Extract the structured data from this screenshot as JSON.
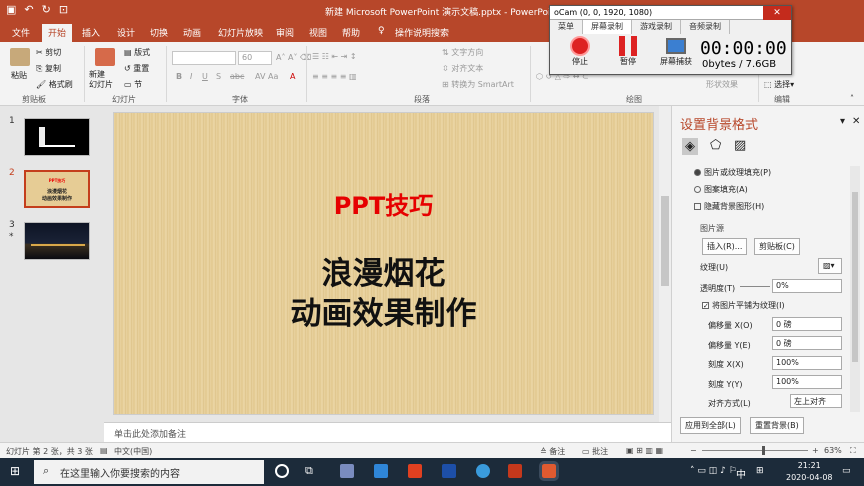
{
  "window": {
    "title": "新建 Microsoft PowerPoint 演示文稿.pptx - PowerPoint",
    "app_name": "PowerPoint"
  },
  "tabs": [
    "文件",
    "开始",
    "插入",
    "设计",
    "切换",
    "动画",
    "幻灯片放映",
    "审阅",
    "视图",
    "帮助",
    "操作说明搜索"
  ],
  "active_tab": "开始",
  "ribbon": {
    "clipboard": {
      "paste": "粘贴",
      "cut": "剪切",
      "copy": "复制",
      "format_painter": "格式刷",
      "label": "剪贴板"
    },
    "slides": {
      "new_slide": "新建\n幻灯片",
      "layout": "版式",
      "reset": "重置",
      "section": "节",
      "label": "幻灯片"
    },
    "font": {
      "label": "字体",
      "size": "60"
    },
    "paragraph": {
      "label": "段落",
      "text_direction": "文字方向",
      "align_text": "对齐文本",
      "smartart": "转换为 SmartArt"
    },
    "drawing": {
      "label": "绘图",
      "effects": "形状效果"
    },
    "editing": {
      "label": "编辑",
      "select": "选择"
    }
  },
  "recorder": {
    "title": "oCam (0, 0, 1920, 1080)",
    "tabs": [
      "菜单",
      "屏幕录制",
      "游戏录制",
      "音频录制"
    ],
    "buttons": [
      "停止",
      "暂停",
      "屏幕捕获"
    ],
    "timer": "00:00:00",
    "size": "0bytes / 7.6GB"
  },
  "thumbnails": [
    {
      "num": "1"
    },
    {
      "num": "2"
    },
    {
      "num": "3",
      "mark": "*"
    }
  ],
  "slide": {
    "title": "PPT技巧",
    "line1": "浪漫烟花",
    "line2": "动画效果制作"
  },
  "notes_placeholder": "单击此处添加备注",
  "format_pane": {
    "title": "设置背景格式",
    "fill_options": [
      "图片或纹理填充(P)",
      "图案填充(A)",
      "隐藏背景图形(H)"
    ],
    "picture_source": "图片源",
    "insert_btn": "插入(R)...",
    "clipboard_btn": "剪贴板(C)",
    "texture": "纹理(U)",
    "transparency_label": "透明度(T)",
    "transparency_value": "0%",
    "tile_label": "将图片平铺为纹理(I)",
    "offset_x_label": "偏移量 X(O)",
    "offset_x_value": "0 磅",
    "offset_y_label": "偏移量 Y(E)",
    "offset_y_value": "0 磅",
    "scale_x_label": "刻度 X(X)",
    "scale_x_value": "100%",
    "scale_y_label": "刻度 Y(Y)",
    "scale_y_value": "100%",
    "align_label": "对齐方式(L)",
    "align_value": "左上对齐",
    "apply_all": "应用到全部(L)",
    "reset_bg": "重置背景(B)"
  },
  "status": {
    "slide_info": "幻灯片 第 2 张，共 3 张",
    "language": "中文(中国)",
    "notes": "备注",
    "comments": "批注",
    "zoom": "63%"
  },
  "taskbar": {
    "search_placeholder": "在这里输入你要搜索的内容",
    "ime": "中",
    "time": "21:21",
    "date": "2020-04-08"
  }
}
